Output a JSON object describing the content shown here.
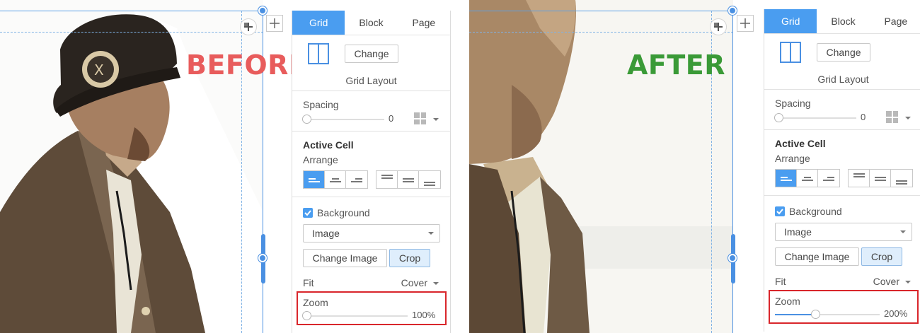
{
  "before": {
    "stage_label": "BEFORE",
    "panel": {
      "tabs": [
        "Grid",
        "Block",
        "Page"
      ],
      "active_tab": "Grid",
      "change_label": "Change",
      "grid_layout_label": "Grid Layout",
      "spacing_label": "Spacing",
      "spacing_value": "0",
      "active_cell_label": "Active Cell",
      "arrange_label": "Arrange",
      "background_label": "Background",
      "background_checked": true,
      "background_type": "Image",
      "change_image_label": "Change Image",
      "crop_label": "Crop",
      "fit_label": "Fit",
      "fit_value": "Cover",
      "zoom_label": "Zoom",
      "zoom_value": "100%",
      "zoom_fraction": 0.0
    }
  },
  "after": {
    "stage_label": "AFTER",
    "panel": {
      "tabs": [
        "Grid",
        "Block",
        "Page"
      ],
      "active_tab": "Grid",
      "change_label": "Change",
      "grid_layout_label": "Grid Layout",
      "spacing_label": "Spacing",
      "spacing_value": "0",
      "active_cell_label": "Active Cell",
      "arrange_label": "Arrange",
      "background_label": "Background",
      "background_checked": true,
      "background_type": "Image",
      "change_image_label": "Change Image",
      "crop_label": "Crop",
      "fit_label": "Fit",
      "fit_value": "Cover",
      "zoom_label": "Zoom",
      "zoom_value": "200%",
      "zoom_fraction": 0.35
    }
  },
  "colors": {
    "accent": "#4a9df0",
    "before_label": "#e85c5c",
    "after_label": "#3a9a37",
    "highlight": "#d9262b"
  },
  "icons": {
    "grid_layout": "two-column-layout-icon",
    "add": "plus-icon",
    "move": "move-icon",
    "layout_mini": "four-squares-icon"
  }
}
